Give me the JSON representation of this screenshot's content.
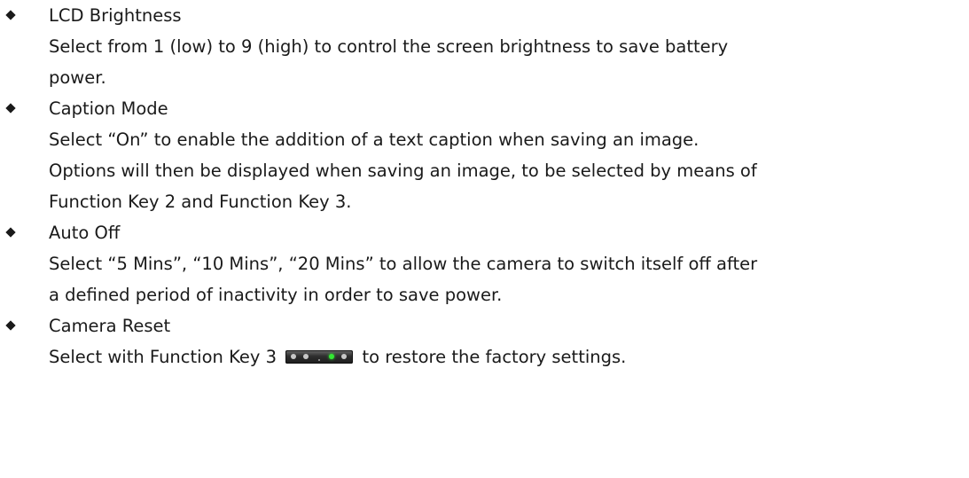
{
  "items": [
    {
      "title": "LCD Brightness",
      "lines": [
        "Select from 1 (low) to 9 (high) to control the screen brightness to save battery",
        "power."
      ]
    },
    {
      "title": "Caption Mode",
      "lines": [
        "Select “On” to enable the addition of a text caption when saving an image.",
        "Options will then be displayed when saving an image, to be selected by means of",
        "Function Key 2 and Function Key 3."
      ]
    },
    {
      "title": "Auto Off",
      "lines": [
        "Select “5 Mins”, “10 Mins”, “20 Mins” to allow the camera to switch itself off after",
        "a defined period of inactivity in order to save power."
      ]
    },
    {
      "title": "Camera Reset",
      "line_before_icon": "Select with Function Key 3",
      "line_after_icon": "to restore the factory settings.",
      "icon": "function-key-3-icon"
    }
  ],
  "colors": {
    "text": "#1a1a1a",
    "key_led_on": "#33e833",
    "key_led_off": "#c8c8c8"
  }
}
